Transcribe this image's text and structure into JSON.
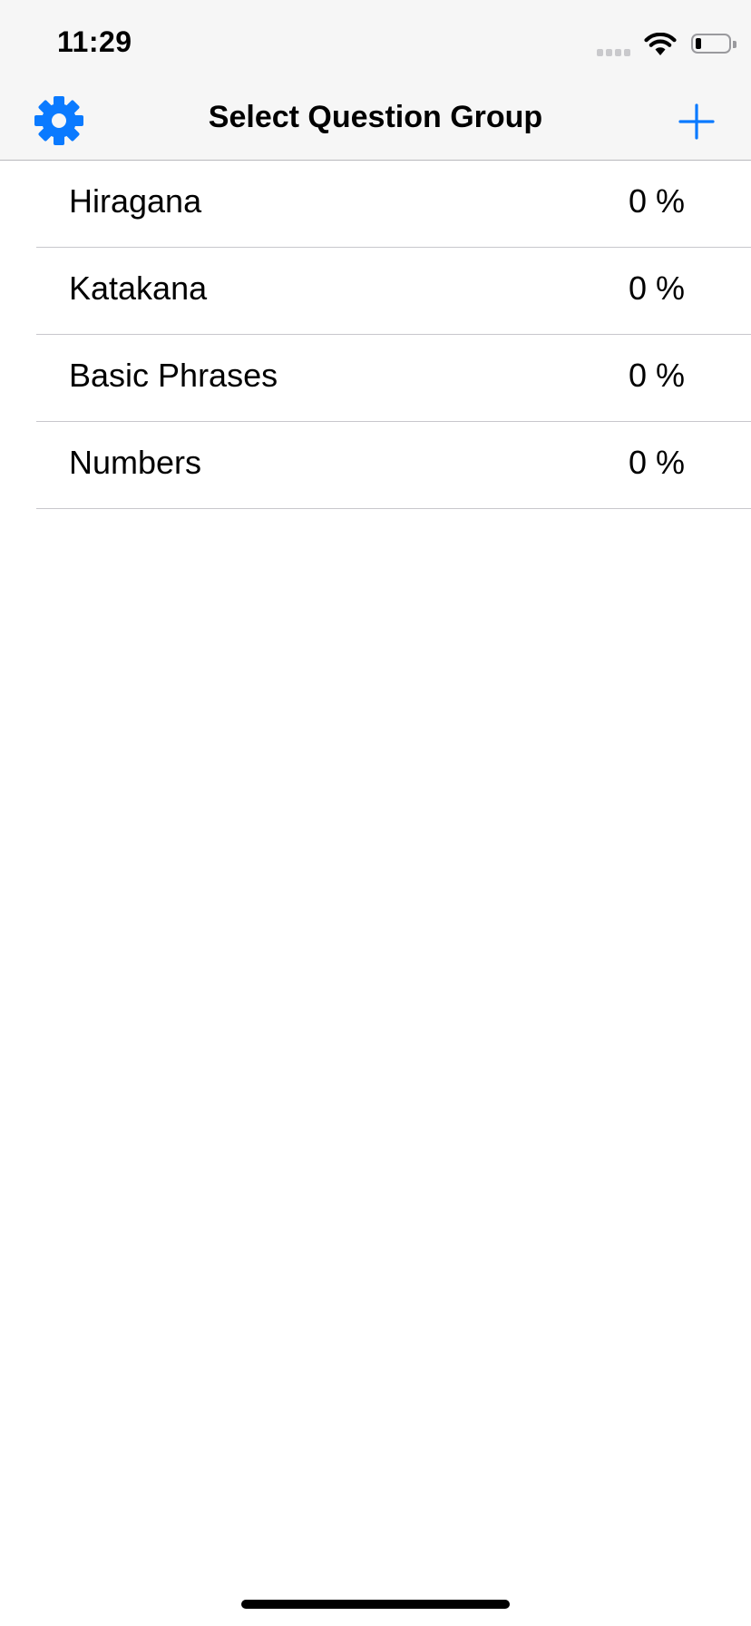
{
  "status_bar": {
    "time": "11:29",
    "signal_icon": "cellular-signal-icon",
    "wifi_icon": "wifi-icon",
    "battery_icon": "battery-icon",
    "battery_level": 0.18
  },
  "nav_bar": {
    "title": "Select Question Group",
    "left_button_icon": "gear-icon",
    "right_button_icon": "plus-icon",
    "accent_color": "#0a7aff"
  },
  "groups": [
    {
      "name": "Hiragana",
      "progress": "0 %"
    },
    {
      "name": "Katakana",
      "progress": "0 %"
    },
    {
      "name": "Basic Phrases",
      "progress": "0 %"
    },
    {
      "name": "Numbers",
      "progress": "0 %"
    }
  ]
}
